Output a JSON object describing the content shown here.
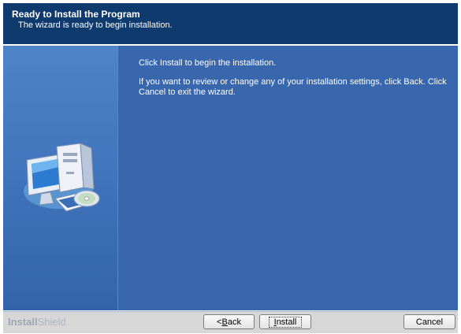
{
  "header": {
    "title": "Ready to Install the Program",
    "subtitle": "The wizard is ready to begin installation."
  },
  "content": {
    "line1": "Click Install to begin the installation.",
    "line2": "If you want to review or change any of your installation settings, click Back. Click Cancel to exit the wizard."
  },
  "footer": {
    "brand_primary": "Install",
    "brand_secondary": "Shield",
    "back_label_prefix": "< ",
    "back_label_mnemonic": "B",
    "back_label_rest": "ack",
    "install_label_mnemonic": "I",
    "install_label_rest": "nstall",
    "cancel_label": "Cancel"
  },
  "colors": {
    "header_bg": "#0f3a6e",
    "body_bg": "#3867ad",
    "footer_bg": "#d7d7d7"
  },
  "icons": {
    "illustration": "computer-cd-icon"
  }
}
